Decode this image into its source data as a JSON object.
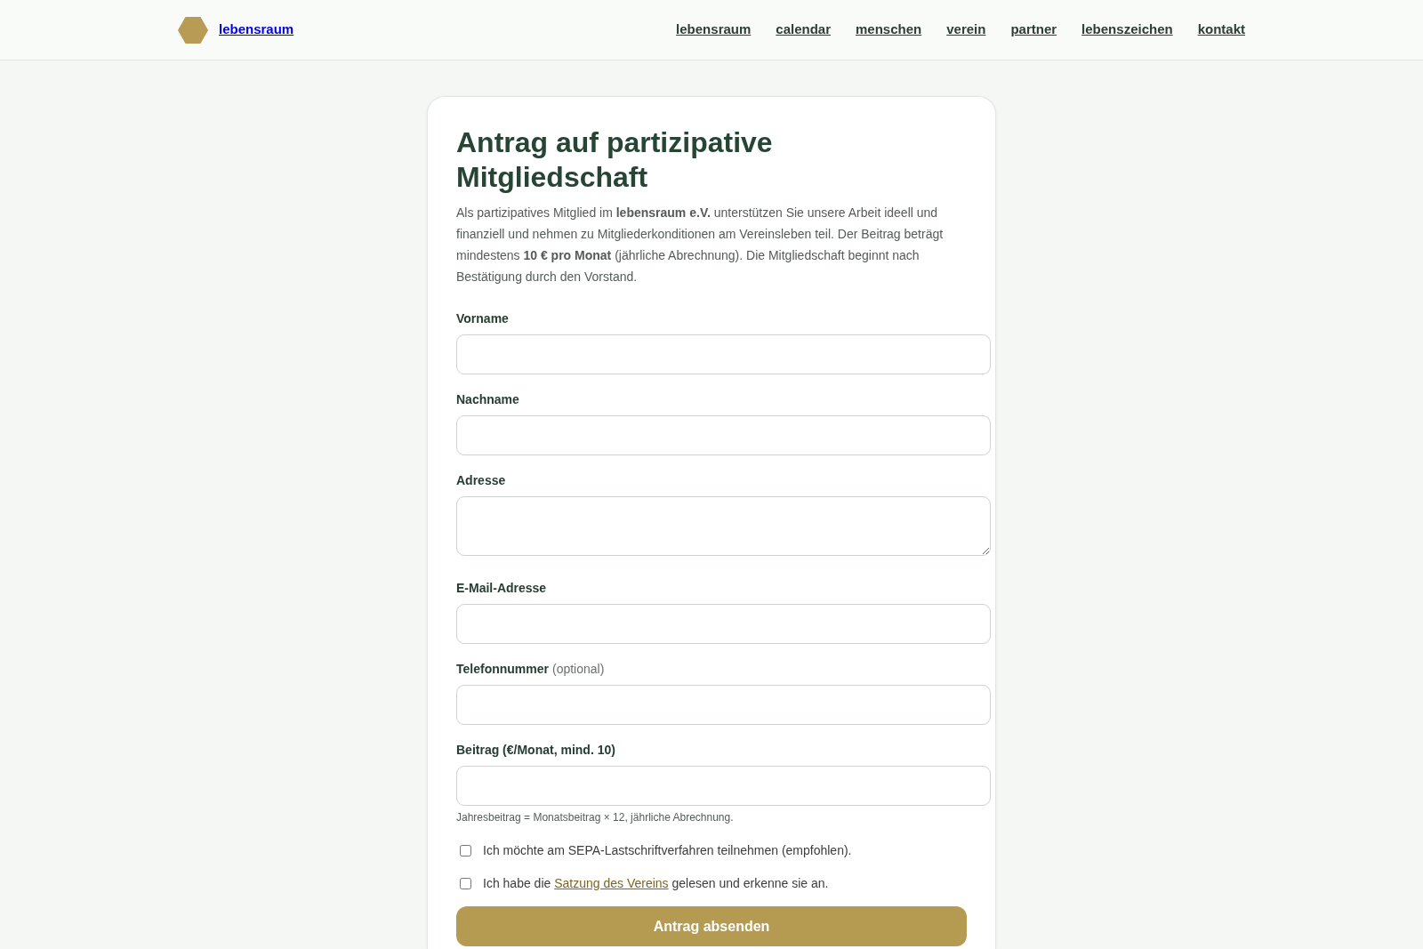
{
  "header": {
    "logo_text": "lebensraum",
    "nav": [
      {
        "label": "lebensraum"
      },
      {
        "label": "calendar"
      },
      {
        "label": "menschen"
      },
      {
        "label": "verein"
      },
      {
        "label": "partner"
      },
      {
        "label": "lebenszeichen"
      },
      {
        "label": "kontakt"
      }
    ]
  },
  "form": {
    "title": "Antrag auf partizipative Mitgliedschaft",
    "intro": "Als partizipatives Mitglied im **lebensraum e.V.** unterstützen Sie unsere Arbeit ideell und finanziell und nehmen zu Mitgliederkonditionen am Vereinsleben teil. Der Beitrag beträgt mindestens **10 € pro Monat** (jährliche Abrechnung). Die Mitgliedschaft beginnt nach Bestätigung durch den Vorstand.",
    "fields": [
      {
        "label": "Vorname",
        "kind": "input"
      },
      {
        "label": "Nachname",
        "kind": "input"
      },
      {
        "label": "Adresse",
        "kind": "textarea"
      },
      {
        "label": "E-Mail-Adresse",
        "kind": "input"
      },
      {
        "label": "Telefonnummer",
        "note": "(optional)",
        "kind": "input"
      },
      {
        "label": "Beitrag (€/Monat, mind. 10)",
        "kind": "input",
        "hint": "Jahresbeitrag = Monatsbeitrag × 12, jährliche Abrechnung."
      }
    ],
    "checkboxes": [
      {
        "text": "Ich möchte am SEPA-Lastschriftverfahren teilnehmen (empfohlen).",
        "checked": false
      },
      {
        "text": "Ich habe die",
        "link": "Satzung des Vereins",
        "text_after": "gelesen und erkenne sie an.",
        "checked": false
      }
    ],
    "submit": "Antrag absenden"
  }
}
